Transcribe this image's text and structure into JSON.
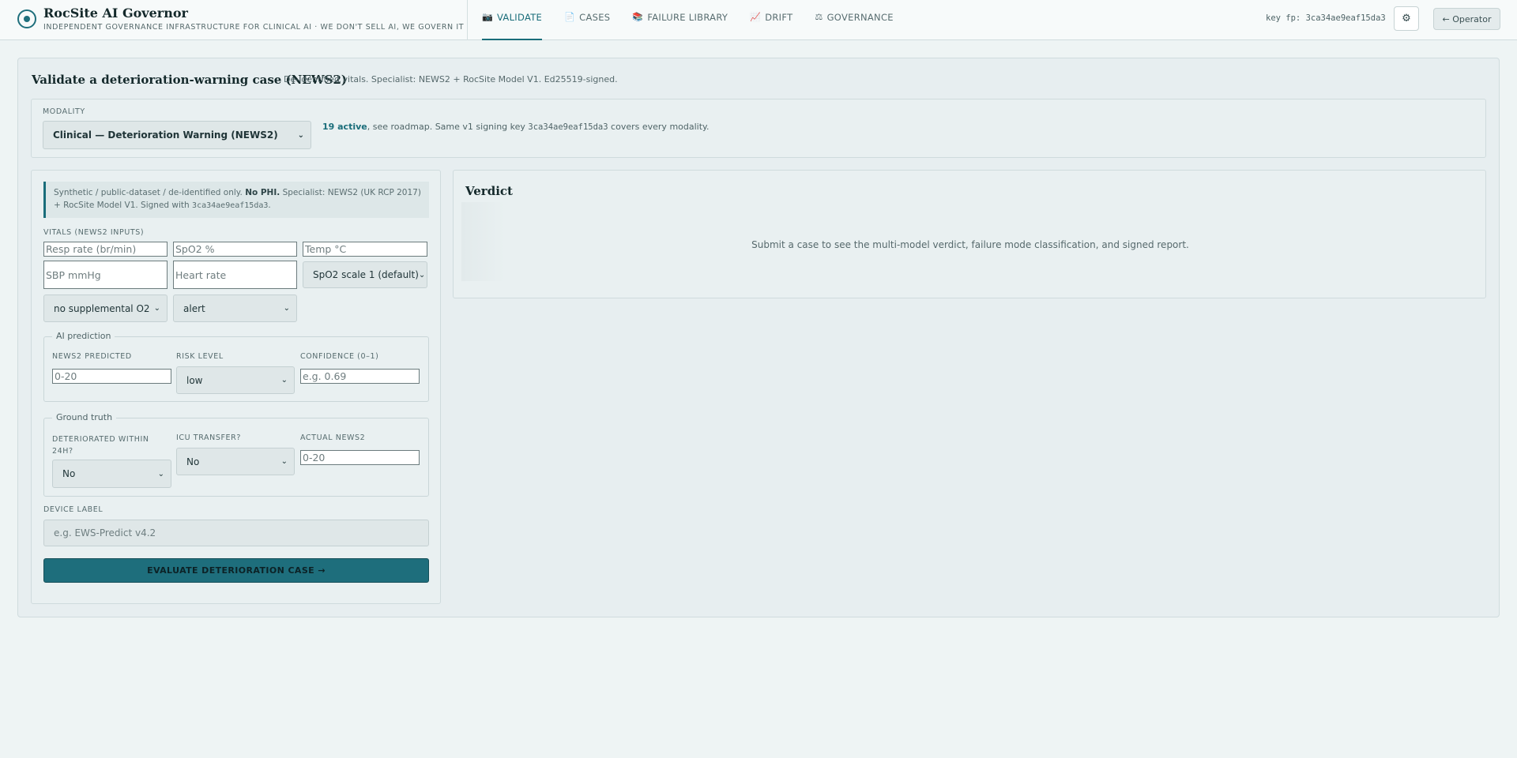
{
  "header": {
    "title": "RocSite AI Governor",
    "subtitle": "INDEPENDENT GOVERNANCE INFRASTRUCTURE FOR CLINICAL AI · WE DON'T SELL AI, WE GOVERN IT",
    "key_fp": "key fp: 3ca34ae9eaf15da3",
    "settings_icon": "⚙",
    "operator_label": "← Operator"
  },
  "nav": {
    "tabs": [
      {
        "icon": "📷",
        "label": "VALIDATE",
        "active": true
      },
      {
        "icon": "📄",
        "label": "CASES",
        "active": false
      },
      {
        "icon": "📚",
        "label": "FAILURE LIBRARY",
        "active": false
      },
      {
        "icon": "📈",
        "label": "DRIFT",
        "active": false
      },
      {
        "icon": "⚖",
        "label": "GOVERNANCE",
        "active": false
      }
    ]
  },
  "panel": {
    "title": "Validate a deterioration-warning case (NEWS2)",
    "subtitle": "De-identified vitals. Specialist: NEWS2 + RocSite Model V1. Ed25519-signed."
  },
  "modality": {
    "label": "MODALITY",
    "selected": "Clinical — Deterioration Warning (NEWS2)",
    "note_accent": "19 active",
    "note_text_1": ", see ",
    "note_link": "roadmap",
    "note_text_2": ". Same v1 signing key ",
    "note_key": "3ca34ae9eaf15da3",
    "note_text_3": " covers every modality."
  },
  "notice": {
    "text_1": "Synthetic / public-dataset / de-identified only. ",
    "bold": "No PHI.",
    "text_2": " Specialist: NEWS2 (UK RCP 2017) + RocSite Model V1. Signed with ",
    "key": "3ca34ae9eaf15da3",
    "text_3": "."
  },
  "vitals": {
    "label": "VITALS (NEWS2 INPUTS)",
    "resp_rate_placeholder": "Resp rate (br/min)",
    "spo2_placeholder": "SpO2 %",
    "temp_placeholder": "Temp °C",
    "sbp_placeholder": "SBP mmHg",
    "hr_placeholder": "Heart rate",
    "spo2_scale": "SpO2 scale 1 (default)",
    "oxygen": "no supplemental O2",
    "consciousness": "alert"
  },
  "ai_prediction": {
    "legend": "AI prediction",
    "news2_label": "NEWS2 PREDICTED",
    "news2_placeholder": "0-20",
    "risk_label": "RISK LEVEL",
    "risk_value": "low",
    "confidence_label": "CONFIDENCE (0–1)",
    "confidence_placeholder": "e.g. 0.69"
  },
  "ground_truth": {
    "legend": "Ground truth",
    "deteriorated_label_1": "DETERIORATED WITHIN",
    "deteriorated_label_2": "24H?",
    "deteriorated_value": "No",
    "icu_label": "ICU TRANSFER?",
    "icu_value": "No",
    "actual_label": "ACTUAL NEWS2",
    "actual_placeholder": "0-20"
  },
  "device": {
    "label": "DEVICE LABEL",
    "placeholder": "e.g. EWS-Predict v4.2"
  },
  "submit_label": "EVALUATE DETERIORATION CASE →",
  "verdict": {
    "title": "Verdict",
    "empty": "Submit a case to see the multi-model verdict, failure mode classification, and signed report."
  },
  "colors": {
    "accent": "#1a6d7a",
    "background": "#eef4f4",
    "panel": "#e7eef0"
  }
}
